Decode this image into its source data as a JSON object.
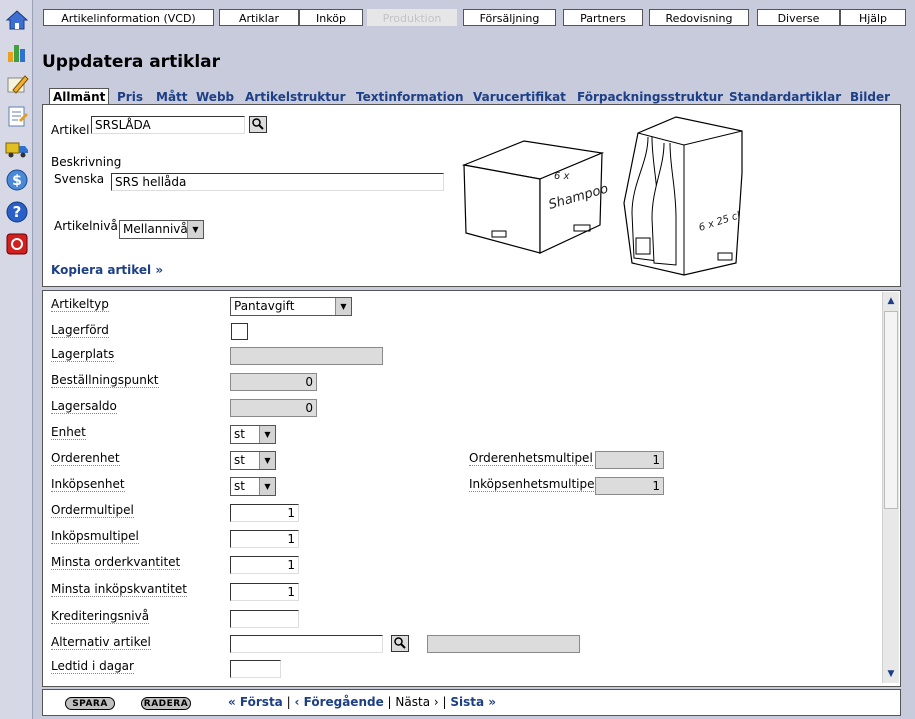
{
  "menu": [
    {
      "label": "Artikelinformation (VCD)",
      "disabled": false
    },
    {
      "label": "Artiklar",
      "disabled": false
    },
    {
      "label": "Inköp",
      "disabled": false
    },
    {
      "label": "Produktion",
      "disabled": true
    },
    {
      "label": "Försäljning",
      "disabled": false
    },
    {
      "label": "Partners",
      "disabled": false
    },
    {
      "label": "Redovisning",
      "disabled": false
    },
    {
      "label": "Diverse",
      "disabled": false
    },
    {
      "label": "Hjälp",
      "disabled": false
    }
  ],
  "sidebar_icons": [
    "home-icon",
    "chart-icon",
    "pencil-icon",
    "notes-icon",
    "truck-icon",
    "dollar-icon",
    "help-icon",
    "exit-icon"
  ],
  "page_title": "Uppdatera artiklar",
  "tabs": [
    "Allmänt",
    "Pris",
    "Mått",
    "Webb",
    "Artikelstruktur",
    "Textinformation",
    "Varucertifikat",
    "Förpackningsstruktur",
    "Standardartiklar",
    "Bilder"
  ],
  "header": {
    "artikel_label": "Artikel",
    "artikel_value": "SRSLÅDA",
    "beskrivning_label": "Beskrivning",
    "svenska_label": "Svenska",
    "svenska_value": "SRS hellåda",
    "artikelniva_label": "Artikelnivå",
    "artikelniva_value": "Mellannivå",
    "kopiera_link": "Kopiera artikel »",
    "box_text_top": "6 x",
    "box_text_side": "Shampoo",
    "bottle_text": "6 x 25 cl"
  },
  "fields": {
    "artikeltyp": {
      "label": "Artikeltyp",
      "value": "Pantavgift"
    },
    "lagerford": {
      "label": "Lagerförd"
    },
    "lagerplats": {
      "label": "Lagerplats",
      "value": ""
    },
    "bestallningspunkt": {
      "label": "Beställningspunkt",
      "value": "0"
    },
    "lagersaldo": {
      "label": "Lagersaldo",
      "value": "0"
    },
    "enhet": {
      "label": "Enhet",
      "value": "st"
    },
    "orderenhet": {
      "label": "Orderenhet",
      "value": "st"
    },
    "orderenhetsmultipel": {
      "label": "Orderenhetsmultipel",
      "value": "1"
    },
    "inkopsenhet": {
      "label": "Inköpsenhet",
      "value": "st"
    },
    "inkopsenhetsmultipel": {
      "label": "Inköpsenhetsmultipel",
      "value": "1"
    },
    "ordermultipel": {
      "label": "Ordermultipel",
      "value": "1"
    },
    "inkopsmultipel": {
      "label": "Inköpsmultipel",
      "value": "1"
    },
    "minsta_orderkvantitet": {
      "label": "Minsta orderkvantitet",
      "value": "1"
    },
    "minsta_inkopskvantitet": {
      "label": "Minsta inköpskvantitet",
      "value": "1"
    },
    "krediteringsniva": {
      "label": "Krediteringsnivå",
      "value": ""
    },
    "alternativ_artikel": {
      "label": "Alternativ artikel",
      "value": ""
    },
    "ledtid": {
      "label": "Ledtid i dagar",
      "value": ""
    }
  },
  "footer": {
    "spara": "SPARA",
    "radera": "RADERA",
    "forsta": "« Första",
    "foregaende": "‹ Föregående",
    "nasta": "Nästa ›",
    "sista": "Sista »",
    "separator": "|"
  }
}
